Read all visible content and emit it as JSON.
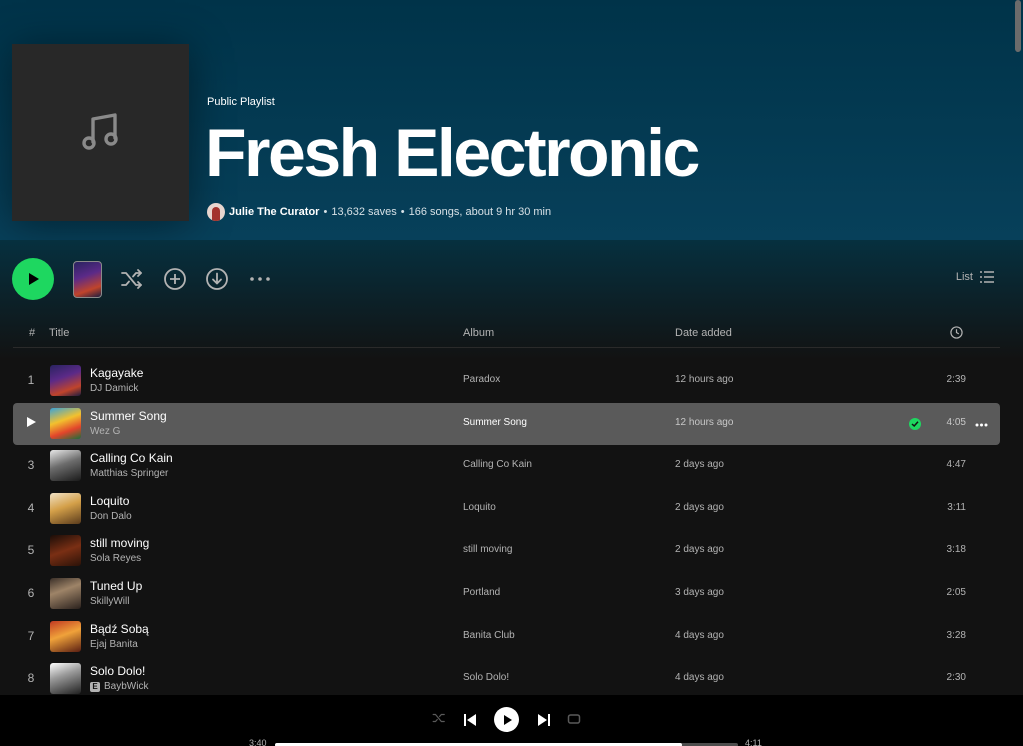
{
  "playlist": {
    "kind": "Public Playlist",
    "title": "Fresh Electronic",
    "owner": "Julie The Curator",
    "saves": "13,632 saves",
    "stats": "166 songs, about 9 hr 30 min",
    "separator": "•"
  },
  "actions": {
    "view_label": "List",
    "icons": [
      "play-icon",
      "shuffle-icon",
      "add-icon",
      "download-icon",
      "more-icon",
      "list-icon"
    ]
  },
  "table": {
    "headers": {
      "num": "#",
      "title": "Title",
      "album": "Album",
      "date": "Date added",
      "duration_icon": "clock-icon"
    },
    "rows": [
      {
        "num": "1",
        "title": "Kagayake",
        "artist": "DJ Damick",
        "album": "Paradox",
        "date": "12 hours ago",
        "duration": "2:39",
        "explicit": false
      },
      {
        "num": "2",
        "title": "Summer Song",
        "artist": "Wez G",
        "album": "Summer Song",
        "date": "12 hours ago",
        "duration": "4:05",
        "explicit": false,
        "active": true,
        "saved": true
      },
      {
        "num": "3",
        "title": "Calling Co Kain",
        "artist": "Matthias Springer",
        "album": "Calling Co Kain",
        "date": "2 days ago",
        "duration": "4:47",
        "explicit": false
      },
      {
        "num": "4",
        "title": "Loquito",
        "artist": "Don Dalo",
        "album": "Loquito",
        "date": "2 days ago",
        "duration": "3:11",
        "explicit": false
      },
      {
        "num": "5",
        "title": "still moving",
        "artist": "Sola Reyes",
        "album": "still moving",
        "date": "2 days ago",
        "duration": "3:18",
        "explicit": false
      },
      {
        "num": "6",
        "title": "Tuned Up",
        "artist": "SkillyWill",
        "album": "Portland",
        "date": "3 days ago",
        "duration": "2:05",
        "explicit": false
      },
      {
        "num": "7",
        "title": "Bądź Sobą",
        "artist": "Ejaj Banita",
        "album": "Banita Club",
        "date": "4 days ago",
        "duration": "3:28",
        "explicit": false
      },
      {
        "num": "8",
        "title": "Solo Dolo!",
        "artist": "BaybWick",
        "album": "Solo Dolo!",
        "date": "4 days ago",
        "duration": "2:30",
        "explicit": true,
        "explicit_label": "E"
      }
    ]
  },
  "player": {
    "elapsed": "3:40",
    "total": "4:11",
    "progress_fraction": 0.88
  },
  "colors": {
    "accent": "#1ed760",
    "hero": "#003349",
    "background": "#121212"
  }
}
